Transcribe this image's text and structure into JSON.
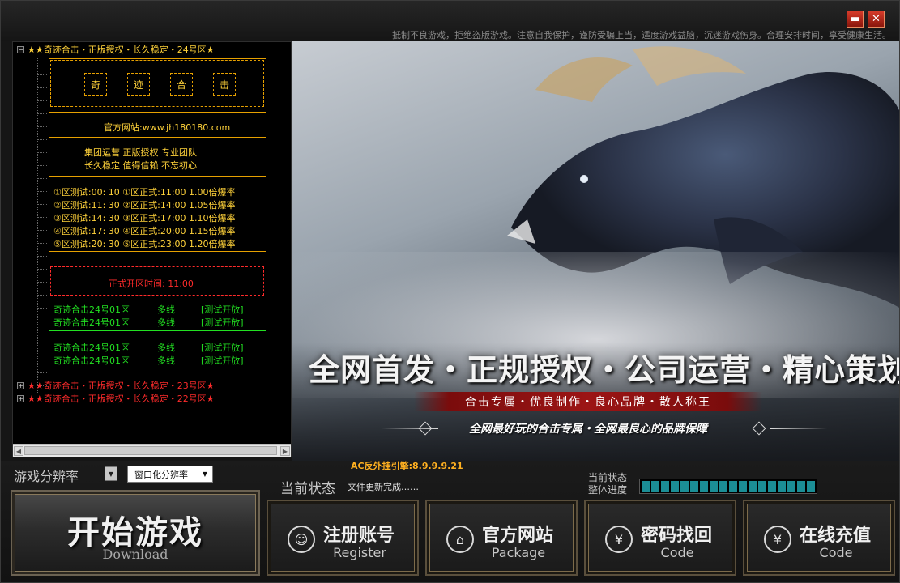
{
  "window": {
    "notice": "抵制不良游戏，拒绝盗版游戏。注意自我保护，谨防受骗上当，适度游戏益脑，沉迷游戏伤身。合理安排时间，享受健康生活。",
    "min_glyph": "▬",
    "close_glyph": "✕"
  },
  "tree": {
    "server_24": "★★奇迹合击・正版授权・长久稳定・24号区★",
    "server_23": "★★奇迹合击・正版授权・长久稳定・23号区★",
    "server_22": "★★奇迹合击・正版授权・长久稳定・22号区★",
    "expand_glyph": "−",
    "collapse_glyph": "+",
    "chars": [
      "奇",
      "迹",
      "合",
      "击"
    ],
    "website": "官方网站:www.jh180180.com",
    "motto_1": "集团运营     正版授权     专业团队",
    "motto_2": "长久稳定     值得信赖     不忘初心",
    "schedule": [
      "①区测试:00: 10 ①区正式:11:00  1.00倍爆率",
      "②区测试:11: 30 ②区正式:14:00  1.05倍爆率",
      "③区测试:14: 30 ③区正式:17:00  1.10倍爆率",
      "④区测试:17: 30 ④区正式:20:00  1.15倍爆率",
      "⑤区测试:20: 30 ⑤区正式:23:00  1.20倍爆率"
    ],
    "open_time": "正式开区时间:  11:00",
    "zones": [
      {
        "name": "奇迹合击24号01区",
        "line": "多线",
        "state": "[测试开放]"
      },
      {
        "name": "奇迹合击24号01区",
        "line": "多线",
        "state": "[测试开放]"
      },
      {
        "name": "奇迹合击24号01区",
        "line": "多线",
        "state": "[测试开放]"
      },
      {
        "name": "奇迹合击24号01区",
        "line": "多线",
        "state": "[测试开放]"
      }
    ]
  },
  "banner": {
    "headline": "全网首发・正规授权・公司运营・精心策划",
    "ribbon": "合击专属・优良制作・良心品牌・散人称王",
    "slogan": "全网最好玩的合击专属・全网最良心的品牌保障"
  },
  "anticheat": "AC反外挂引擎:8.9.9.9.21",
  "resolution": {
    "label": "游戏分辨率",
    "selected": "窗口化分辨率",
    "toggle_glyph": "▼",
    "dropdown_glyph": "▼"
  },
  "status": {
    "label": "当前状态",
    "text": "文件更新完成……",
    "current_label": "当前状态",
    "overall_label": "整体进度",
    "progress": 1.0
  },
  "start_button": {
    "label": "开始游戏",
    "sub": "Download"
  },
  "actions": [
    {
      "label": "注册账号",
      "sub": "Register",
      "icon": "☺"
    },
    {
      "label": "官方网站",
      "sub": "Package",
      "icon": "⌂"
    },
    {
      "label": "密码找回",
      "sub": "Code",
      "icon": "¥"
    },
    {
      "label": "在线充值",
      "sub": "Code",
      "icon": "¥"
    }
  ]
}
